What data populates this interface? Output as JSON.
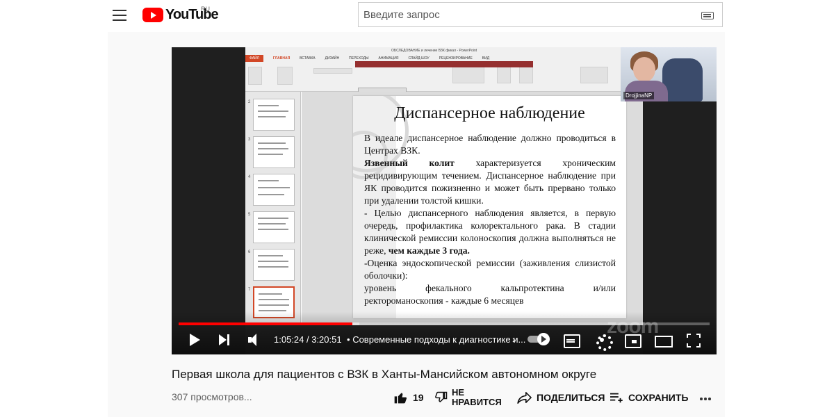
{
  "header": {
    "logo_text": "YouTube",
    "region": "RU",
    "search_placeholder": "Введите запрос"
  },
  "player": {
    "app_title": "ОБСЛЕДОВАНИЕ и лечение ВЗК фикал - PowerPoint",
    "ribbon_tabs": [
      "ФАЙЛ",
      "ГЛАВНАЯ",
      "ВСТАВКА",
      "ДИЗАЙН",
      "ПЕРЕХОДЫ",
      "АНИМАЦИЯ",
      "СЛАЙД-ШОУ",
      "РЕЦЕНЗИРОВАНИЕ",
      "ВИД"
    ],
    "webcam_name": "DrojjinaNP",
    "thumbnail_numbers": [
      "2",
      "3",
      "4",
      "5",
      "6",
      "7"
    ],
    "slide": {
      "title": "Диспансерное наблюдение",
      "p1": "В идеале диспансерное наблюдение должно проводиться в Центрах ВЗК.",
      "p2_bold": "Язвенный колит",
      "p2_rest": " характеризуется хроническим рецидивирующим течением. Диспансерное наблюдение при ЯК проводится пожизненно и может быть прервано только при удалении толстой кишки.",
      "p3": "- Целью диспансерного наблюдения является, в первую очередь, профилактика колоректального рака. В стадии клинической ремиссии колоноскопия должна выполняться не реже, ",
      "p3_bold": "чем каждые 3 года.",
      "p4": "-Оценка эндоскопической ремиссии (заживления слизистой оболочки):",
      "p5": "уровень фекального кальпротектина и/или ректороманоскопия - каждые 6 месяцев"
    },
    "watermark": "zoom",
    "time": "1:05:24 / 3:20:51",
    "chapter_separator": "•",
    "chapter": "Современные подходы к диагностике и...",
    "progress": 0.327,
    "buffered": 0.34,
    "autoplay_on": true
  },
  "video": {
    "title": "Первая школа для пациентов с ВЗК в Ханты-Мансийском автономном округе",
    "views": "307 просмотров..."
  },
  "actions": {
    "like_count": "19",
    "dislike_line1": "НЕ",
    "dislike_line2": "НРАВИТСЯ",
    "share_label": "ПОДЕЛИТЬСЯ",
    "save_label": "СОХРАНИТЬ"
  },
  "colors": {
    "brand_red": "#ff0000",
    "powerpoint_accent": "#d24726"
  }
}
